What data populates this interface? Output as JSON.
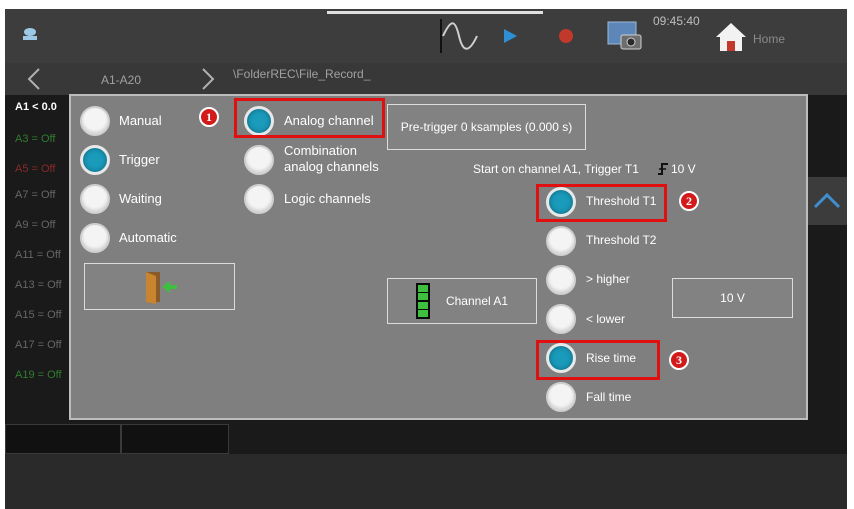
{
  "topbar": {
    "time": "09:45:40",
    "home_label": "Home"
  },
  "navbar": {
    "channels": "A1-A20",
    "path": "\\FolderREC\\File_Record_"
  },
  "background_channels": {
    "first": "A1 < 0.0",
    "items": [
      "A3 = Off",
      "A5 = Off",
      "A7 = Off",
      "A9 = Off",
      "A11 = Off",
      "A13 = Off",
      "A15 = Off",
      "A17 = Off",
      "A19 = Off"
    ]
  },
  "dialog": {
    "mode_options": [
      {
        "label": "Manual",
        "selected": false
      },
      {
        "label": "Trigger",
        "selected": true
      },
      {
        "label": "Waiting",
        "selected": false
      },
      {
        "label": "Automatic",
        "selected": false
      }
    ],
    "source_options": [
      {
        "label": "Analog channel",
        "selected": true
      },
      {
        "label": "Combination\nanalog channels",
        "selected": false
      },
      {
        "label": "Logic channels",
        "selected": false
      }
    ],
    "pretrigger_label": "Pre-trigger 0 ksamples (0.000 s)",
    "start_info": "Start on channel A1, Trigger T1",
    "start_value": "10 V",
    "threshold_options": [
      {
        "label": "Threshold T1",
        "selected": true
      },
      {
        "label": "Threshold T2",
        "selected": false
      }
    ],
    "compare_options": [
      {
        "label": "> higher",
        "selected": false
      },
      {
        "label": "< lower",
        "selected": false
      }
    ],
    "edge_options": [
      {
        "label": "Rise time",
        "selected": true
      },
      {
        "label": "Fall time",
        "selected": false
      }
    ],
    "channel_button": "Channel A1",
    "value_button": "10 V"
  },
  "annotations": [
    "1",
    "2",
    "3"
  ],
  "colors": {
    "dialog_bg": "#7f7f7f",
    "radio_selected": "#1a9bbb",
    "highlight": "#e01010"
  }
}
